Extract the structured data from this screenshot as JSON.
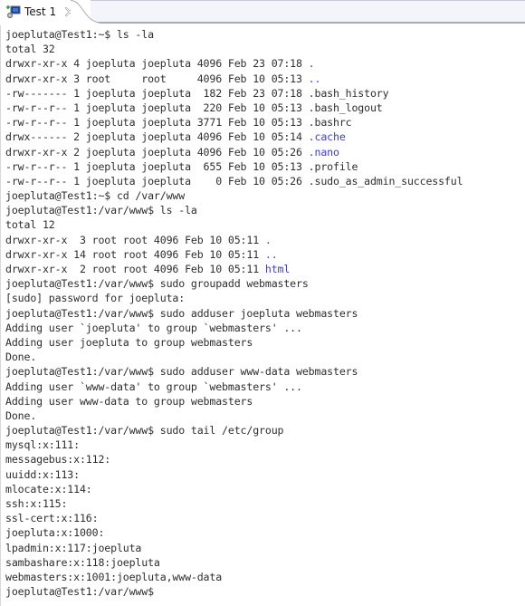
{
  "tab": {
    "title": "Test 1",
    "icon": "terminal-connection-icon",
    "close_icon": "close-icon"
  },
  "colors": {
    "text": "#2e2e2e",
    "directory": "#3c3cd6",
    "background": "#ffffff"
  },
  "terminal": {
    "lines": [
      {
        "text": "joepluta@Test1:~$ ls -la",
        "name": "prompt-line"
      },
      {
        "text": "total 32",
        "name": "output-line"
      },
      {
        "text": "drwxr-xr-x 4 joepluta joepluta 4096 Feb 23 07:18 ",
        "dir": ".",
        "name": "listing-row"
      },
      {
        "text": "drwxr-xr-x 3 root     root     4096 Feb 10 05:13 ",
        "dir": "..",
        "name": "listing-row"
      },
      {
        "text": "-rw------- 1 joepluta joepluta  182 Feb 23 07:18 .bash_history",
        "name": "listing-row"
      },
      {
        "text": "-rw-r--r-- 1 joepluta joepluta  220 Feb 10 05:13 .bash_logout",
        "name": "listing-row"
      },
      {
        "text": "-rw-r--r-- 1 joepluta joepluta 3771 Feb 10 05:13 .bashrc",
        "name": "listing-row"
      },
      {
        "text": "drwx------ 2 joepluta joepluta 4096 Feb 10 05:14 ",
        "dir": ".cache",
        "name": "listing-row"
      },
      {
        "text": "drwxr-xr-x 2 joepluta joepluta 4096 Feb 10 05:26 ",
        "dir": ".nano",
        "name": "listing-row"
      },
      {
        "text": "-rw-r--r-- 1 joepluta joepluta  655 Feb 10 05:13 .profile",
        "name": "listing-row"
      },
      {
        "text": "-rw-r--r-- 1 joepluta joepluta    0 Feb 10 05:26 .sudo_as_admin_successful",
        "name": "listing-row"
      },
      {
        "text": "joepluta@Test1:~$ cd /var/www",
        "name": "prompt-line"
      },
      {
        "text": "joepluta@Test1:/var/www$ ls -la",
        "name": "prompt-line"
      },
      {
        "text": "total 12",
        "name": "output-line"
      },
      {
        "text": "drwxr-xr-x  3 root root 4096 Feb 10 05:11 ",
        "dir": ".",
        "name": "listing-row"
      },
      {
        "text": "drwxr-xr-x 14 root root 4096 Feb 10 05:11 ",
        "dir": "..",
        "name": "listing-row"
      },
      {
        "text": "drwxr-xr-x  2 root root 4096 Feb 10 05:11 ",
        "dir": "html",
        "name": "listing-row"
      },
      {
        "text": "joepluta@Test1:/var/www$ sudo groupadd webmasters",
        "name": "prompt-line"
      },
      {
        "text": "[sudo] password for joepluta:",
        "name": "output-line"
      },
      {
        "text": "joepluta@Test1:/var/www$ sudo adduser joepluta webmasters",
        "name": "prompt-line"
      },
      {
        "text": "Adding user `joepluta' to group `webmasters' ...",
        "name": "output-line"
      },
      {
        "text": "Adding user joepluta to group webmasters",
        "name": "output-line"
      },
      {
        "text": "Done.",
        "name": "output-line"
      },
      {
        "text": "joepluta@Test1:/var/www$ sudo adduser www-data webmasters",
        "name": "prompt-line"
      },
      {
        "text": "Adding user `www-data' to group `webmasters' ...",
        "name": "output-line"
      },
      {
        "text": "Adding user www-data to group webmasters",
        "name": "output-line"
      },
      {
        "text": "Done.",
        "name": "output-line"
      },
      {
        "text": "joepluta@Test1:/var/www$ sudo tail /etc/group",
        "name": "prompt-line"
      },
      {
        "text": "mysql:x:111:",
        "name": "output-line"
      },
      {
        "text": "messagebus:x:112:",
        "name": "output-line"
      },
      {
        "text": "uuidd:x:113:",
        "name": "output-line"
      },
      {
        "text": "mlocate:x:114:",
        "name": "output-line"
      },
      {
        "text": "ssh:x:115:",
        "name": "output-line"
      },
      {
        "text": "ssl-cert:x:116:",
        "name": "output-line"
      },
      {
        "text": "joepluta:x:1000:",
        "name": "output-line"
      },
      {
        "text": "lpadmin:x:117:joepluta",
        "name": "output-line"
      },
      {
        "text": "sambashare:x:118:joepluta",
        "name": "output-line"
      },
      {
        "text": "webmasters:x:1001:joepluta,www-data",
        "name": "output-line"
      },
      {
        "text": "joepluta@Test1:/var/www$ ",
        "name": "prompt-line"
      }
    ]
  }
}
